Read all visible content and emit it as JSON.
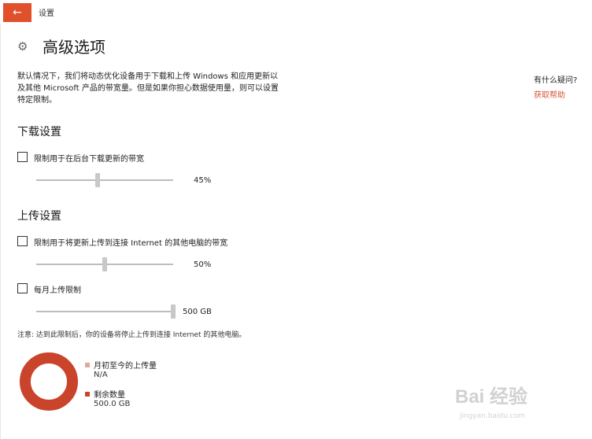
{
  "window": {
    "back_icon": "arrow-left-icon",
    "title": "设置",
    "accent": "#e0502a"
  },
  "page": {
    "icon": "gear-icon",
    "title": "高级选项"
  },
  "intro": "默认情况下，我们将动态优化设备用于下载和上传 Windows 和应用更新以及其他 Microsoft 产品的带宽量。但是如果你担心数据使用量，则可以设置特定限制。",
  "help": {
    "question": "有什么疑问?",
    "link": "获取帮助",
    "link_color": "#d9533a"
  },
  "download": {
    "heading": "下载设置",
    "limit_checkbox": {
      "label": "限制用于在后台下载更新的带宽",
      "checked": false
    },
    "slider": {
      "value_label": "45%",
      "fraction": 0.45
    }
  },
  "upload": {
    "heading": "上传设置",
    "limit_checkbox": {
      "label": "限制用于将更新上传到连接 Internet 的其他电脑的带宽",
      "checked": false
    },
    "slider": {
      "value_label": "50%",
      "fraction": 0.5
    },
    "monthly_checkbox": {
      "label": "每月上传限制",
      "checked": false
    },
    "monthly_slider": {
      "value_label": "500 GB",
      "fraction": 1.0
    }
  },
  "note": "注意: 达到此限制后，你的设备将停止上传到连接 Internet 的其他电脑。",
  "usage": {
    "uploaded": {
      "label": "月初至今的上传量",
      "value": "N/A",
      "color": "#e0a89a"
    },
    "remaining": {
      "label": "剩余数量",
      "value": "500.0 GB",
      "color": "#c9442b"
    },
    "ring_color": "#c9442b"
  },
  "watermark": {
    "logo": "Bai 经验",
    "site": "jingyan.baidu.com"
  }
}
